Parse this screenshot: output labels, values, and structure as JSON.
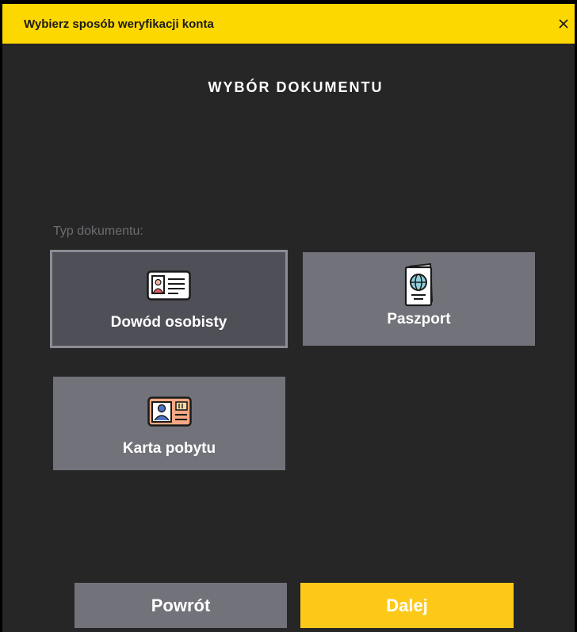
{
  "header": {
    "title": "Wybierz sposób weryfikacji konta",
    "close_icon": "close-icon"
  },
  "main": {
    "title": "WYBÓR DOKUMENTU",
    "document_type_label": "Typ dokumentu:",
    "options": [
      {
        "label": "Dowód osobisty",
        "icon": "id-card-icon",
        "selected": true
      },
      {
        "label": "Paszport",
        "icon": "passport-icon",
        "selected": false
      },
      {
        "label": "Karta pobytu",
        "icon": "residence-card-icon",
        "selected": false
      }
    ]
  },
  "footer": {
    "back_label": "Powrót",
    "next_label": "Dalej"
  },
  "colors": {
    "accent": "#fdd700",
    "button_primary": "#fcc919",
    "card": "#72727a",
    "card_selected": "#4f4f57",
    "background": "#262626"
  }
}
